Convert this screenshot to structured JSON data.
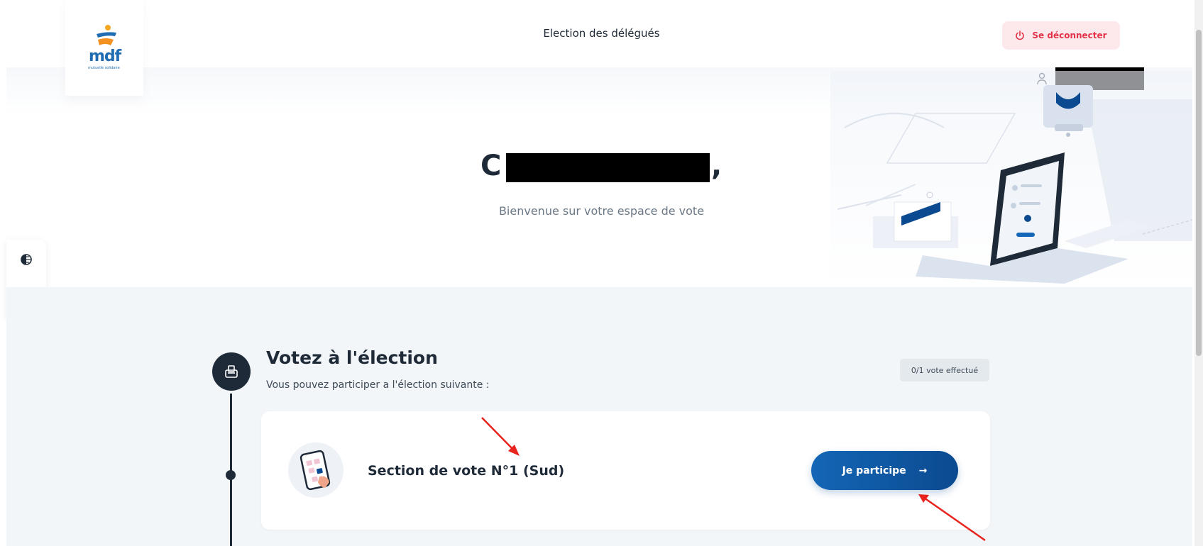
{
  "header": {
    "logo_text": "mdf",
    "logo_subtext": "mutuelle solidaire",
    "title": "Election des délégués",
    "logout_label": "Se déconnecter"
  },
  "hero": {
    "greeting_initial": "C",
    "greeting_comma": ",",
    "welcome": "Bienvenue sur votre espace de vote"
  },
  "election": {
    "title": "Votez à l'élection",
    "subtitle": "Vous pouvez participer a l'élection suivante :",
    "vote_count": "0/1 vote effectué",
    "section_title": "Section de vote N°1 (Sud)",
    "participate_label": "Je participe",
    "participate_arrow": "→"
  },
  "colors": {
    "primary": "#0b4a90",
    "dark": "#1e2a38",
    "logout_bg": "#fde9ec",
    "logout_text": "#e2334a",
    "annotation": "#e8231e"
  },
  "icons": {
    "logout": "power-icon",
    "user": "user-icon",
    "contrast": "contrast-icon",
    "zoom": "zoom-in-icon",
    "ballot": "ballot-box-icon"
  }
}
